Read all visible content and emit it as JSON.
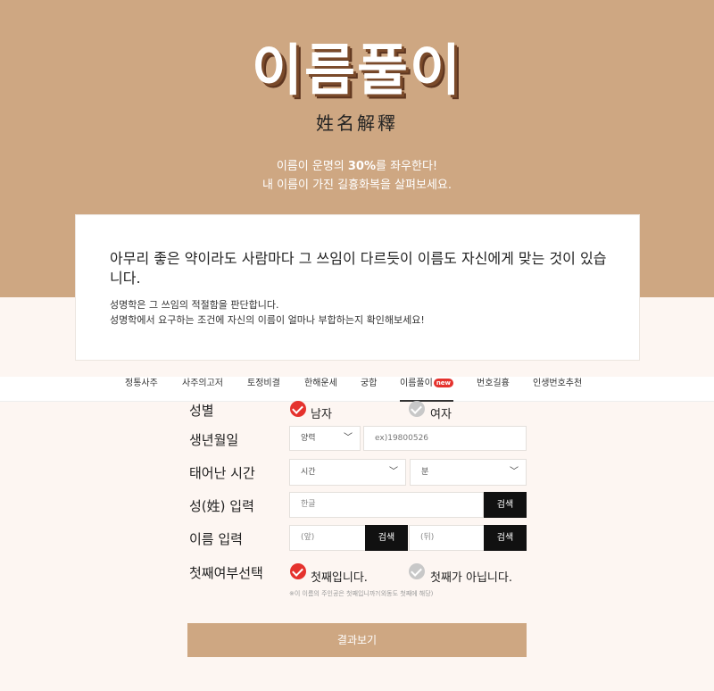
{
  "hero": {
    "title": "이름풀이",
    "subtitle": "姓名解釋",
    "desc_line1_pre": "이름이 운명의 ",
    "desc_line1_bold": "30%",
    "desc_line1_post": "를 좌우한다!",
    "desc_line2": "내 이름이 가진 길흉화복을 살펴보세요."
  },
  "card": {
    "headline": "아무리 좋은 약이라도 사람마다 그 쓰임이 다르듯이 이름도 자신에게 맞는 것이 있습니다.",
    "body_line1": "성명학은 그 쓰임의 적절함을 판단합니다.",
    "body_line2": "성명학에서 요구하는 조건에 자신의 이름이 얼마나 부합하는지 확인해보세요!"
  },
  "tabs": [
    {
      "label": "정통사주"
    },
    {
      "label": "사주의고저"
    },
    {
      "label": "토정비결"
    },
    {
      "label": "한해운세"
    },
    {
      "label": "궁합"
    },
    {
      "label": "이름풀이",
      "badge": "new"
    },
    {
      "label": "번호길흉"
    },
    {
      "label": "인생번호추천"
    }
  ],
  "form": {
    "gender": {
      "label": "성별",
      "male": "남자",
      "female": "여자"
    },
    "birth": {
      "label": "생년월일",
      "calendar": "양력",
      "placeholder": "ex)19800526"
    },
    "time": {
      "label": "태어난 시간",
      "hour": "시간",
      "minute": "분"
    },
    "surname": {
      "label": "성(姓) 입력",
      "placeholder": "한글",
      "search": "검색"
    },
    "name": {
      "label": "이름 입력",
      "front": "(앞)",
      "back": "(뒤)",
      "search": "검색"
    },
    "first": {
      "label": "첫째여부선택",
      "yes": "첫째입니다.",
      "no": "첫째가 아닙니다."
    },
    "note": "※이 이름의 주인공은 첫째입니까?(외동도 첫째에 해당)",
    "submit": "결과보기"
  }
}
